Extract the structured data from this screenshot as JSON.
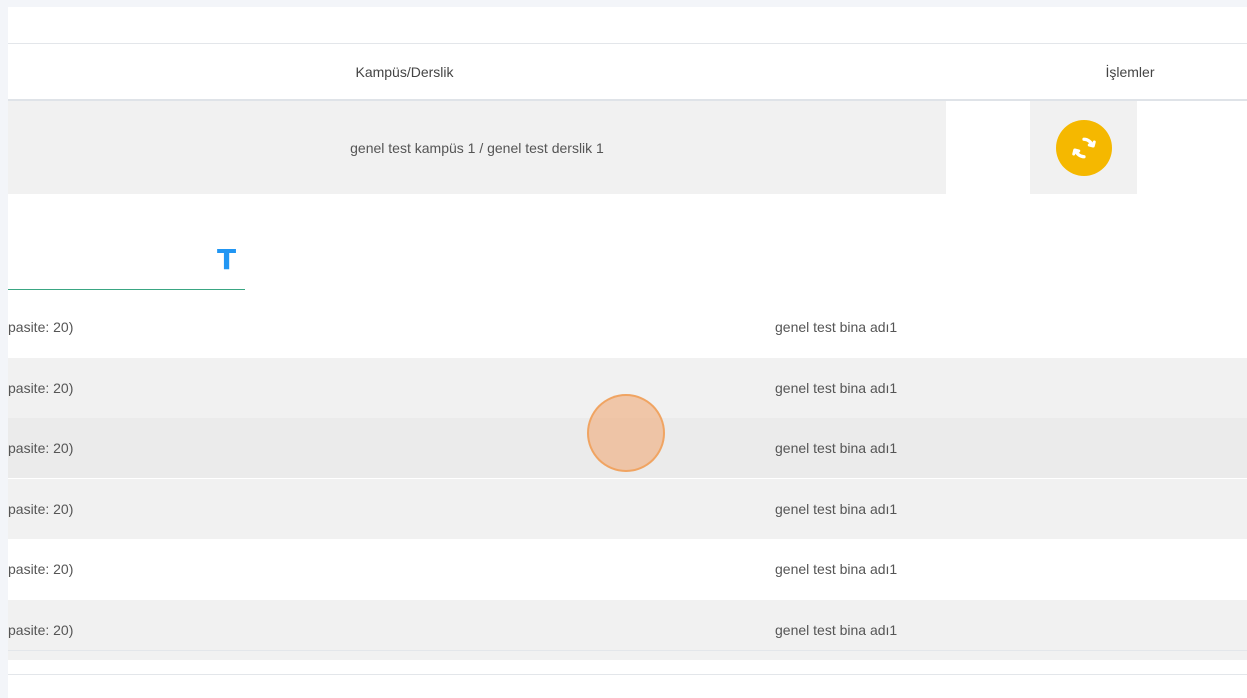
{
  "table": {
    "headers": {
      "kampus_derslik": "Kampüs/Derslik",
      "islemler": "İşlemler"
    },
    "row": {
      "text": "genel test kampüs 1 / genel test derslik 1",
      "action_icon": "sync-icon"
    }
  },
  "search": {
    "value": "",
    "placeholder": "",
    "filter_label": "T"
  },
  "list": {
    "rows": [
      {
        "capacity": "pasite: 20)",
        "building": "genel test bina adı1",
        "shaded": false
      },
      {
        "capacity": "pasite: 20)",
        "building": "genel test bina adı1",
        "shaded": true
      },
      {
        "capacity": "pasite: 20)",
        "building": "genel test bina adı1",
        "shaded": true
      },
      {
        "capacity": "pasite: 20)",
        "building": "genel test bina adı1",
        "shaded": true
      },
      {
        "capacity": "pasite: 20)",
        "building": "genel test bina adı1",
        "shaded": false
      },
      {
        "capacity": "pasite: 20)",
        "building": "genel test bina adı1",
        "shaded": true
      }
    ]
  },
  "colors": {
    "accent_yellow": "#f5b800",
    "filter_blue": "#2196f3",
    "underline_green": "#3aa683",
    "row_shade": "#f1f1f1",
    "row_hover": "#ebebeb"
  }
}
